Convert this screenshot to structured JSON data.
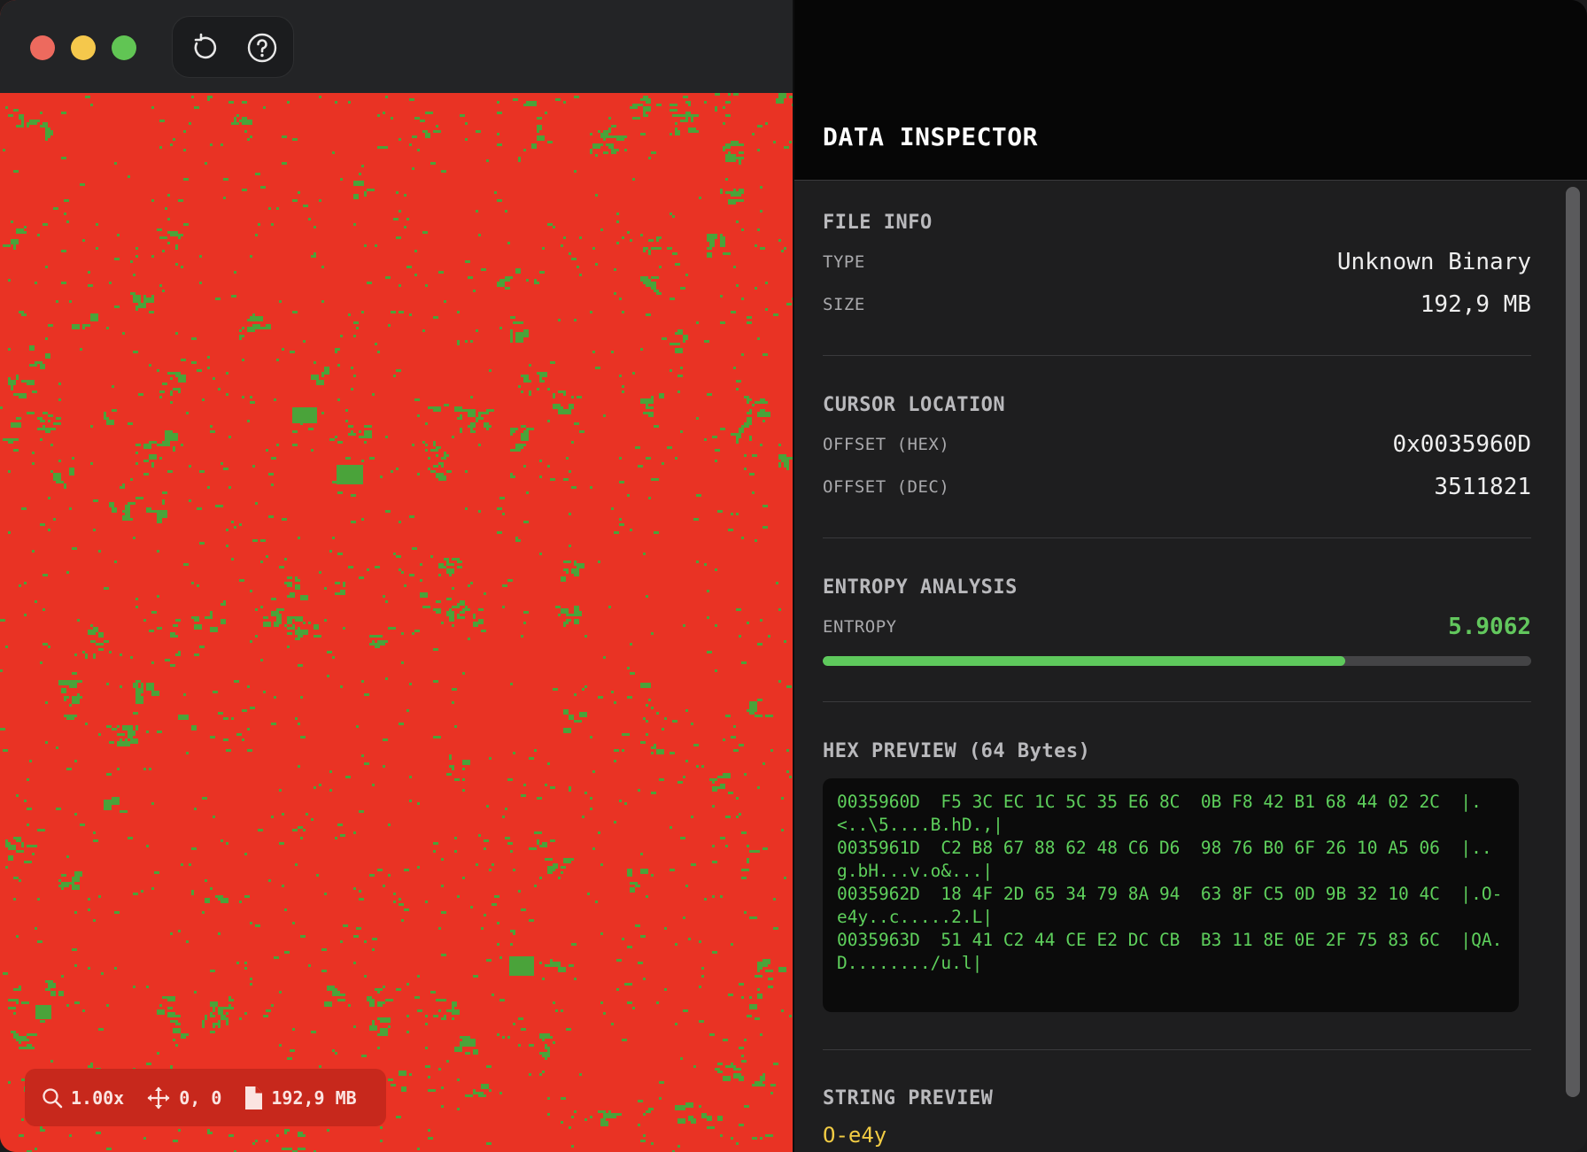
{
  "window": {
    "traffic_lights": [
      "close",
      "minimize",
      "maximize"
    ],
    "toolbar": {
      "icons": [
        "reload-icon",
        "help-icon"
      ]
    }
  },
  "canvas": {
    "background_color": "#e93324",
    "pixel_color": "#4aa33a",
    "status": {
      "zoom": "1.00x",
      "pan": "0, 0",
      "file_size": "192,9 MB"
    }
  },
  "inspector": {
    "title": "DATA INSPECTOR",
    "file_info": {
      "title": "FILE INFO",
      "type_label": "TYPE",
      "type_value": "Unknown Binary",
      "size_label": "SIZE",
      "size_value": "192,9 MB"
    },
    "cursor": {
      "title": "CURSOR LOCATION",
      "hex_label": "OFFSET (HEX)",
      "hex_value": "0x0035960D",
      "dec_label": "OFFSET (DEC)",
      "dec_value": "3511821"
    },
    "entropy": {
      "title": "ENTROPY ANALYSIS",
      "label": "ENTROPY",
      "value": "5.9062",
      "fraction": 0.738,
      "color": "#5ec95c"
    },
    "hex_preview": {
      "title": "HEX PREVIEW (64 Bytes)",
      "lines": [
        "0035960D  F5 3C EC 1C 5C 35 E6 8C  0B F8 42 B1 68 44 02 2C  |.<..\\5....B.hD.,|",
        "0035961D  C2 B8 67 88 62 48 C6 D6  98 76 B0 6F 26 10 A5 06  |..g.bH...v.o&...|",
        "0035962D  18 4F 2D 65 34 79 8A 94  63 8F C5 0D 9B 32 10 4C  |.O-e4y..c.....2.L|",
        "0035963D  51 41 C2 44 CE E2 DC CB  B3 11 8E 0E 2F 75 83 6C  |QA.D......../u.l|"
      ]
    },
    "string_preview": {
      "title": "STRING PREVIEW",
      "value": "O-e4y"
    }
  }
}
